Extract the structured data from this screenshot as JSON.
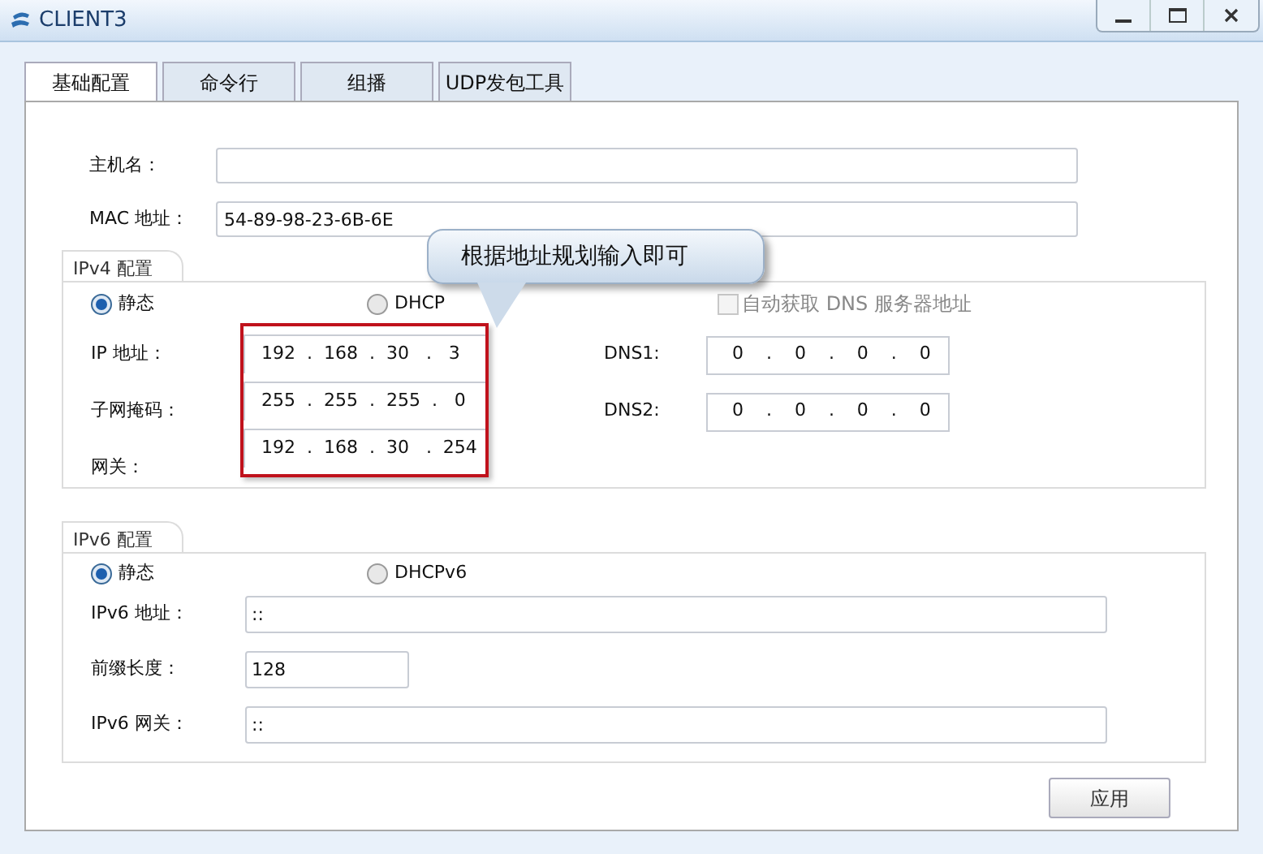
{
  "window": {
    "title": "CLIENT3"
  },
  "tabs": [
    {
      "label": "基础配置",
      "selected": true
    },
    {
      "label": "命令行",
      "selected": false
    },
    {
      "label": "组播",
      "selected": false
    },
    {
      "label": "UDP发包工具",
      "selected": false
    }
  ],
  "hostname": {
    "label": "主机名："
  },
  "mac": {
    "label": "MAC 地址：",
    "value": "54-89-98-23-6B-6E"
  },
  "callout": "根据地址规划输入即可",
  "ipv4": {
    "legend": "IPv4 配置",
    "modes": [
      {
        "label": "静态",
        "selected": true
      },
      {
        "label": "DHCP",
        "selected": false
      }
    ],
    "dns_auto": {
      "label": "自动获取 DNS 服务器地址",
      "checked": false,
      "disabled": true
    },
    "fields": [
      {
        "label": "IP 地址：",
        "value": "192  .  168  .  30   .   3"
      },
      {
        "label": "子网掩码：",
        "value": "255  .  255  .  255  .   0"
      },
      {
        "label": "网关：",
        "value": "192  .  168  .  30   .  254"
      }
    ],
    "dns": [
      {
        "label": "DNS1:",
        "value": "0    .    0    .    0    .    0"
      },
      {
        "label": "DNS2:",
        "value": "0    .    0    .    0    .    0"
      }
    ]
  },
  "ipv6": {
    "legend": "IPv6 配置",
    "modes": [
      {
        "label": "静态",
        "selected": true
      },
      {
        "label": "DHCPv6",
        "selected": false
      }
    ],
    "fields": [
      {
        "label": "IPv6 地址：",
        "value": "::",
        "kind": "wide"
      },
      {
        "label": "前缀长度：",
        "value": "128",
        "kind": "short"
      },
      {
        "label": "IPv6 网关：",
        "value": "::",
        "kind": "wide"
      }
    ]
  },
  "apply": "应用"
}
